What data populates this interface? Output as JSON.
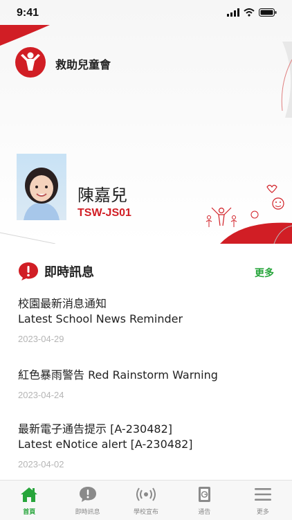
{
  "status_bar": {
    "time": "9:41"
  },
  "header": {
    "org_name": "救助兒童會"
  },
  "profile": {
    "name": "陳嘉兒",
    "student_id": "TSW-JS01"
  },
  "messages_section": {
    "title": "即時訊息",
    "more_label": "更多"
  },
  "news": [
    {
      "title_line1": "校園最新消息通知",
      "title_line2": "Latest School News Reminder",
      "date": "2023-04-29"
    },
    {
      "title_line1": "紅色暴雨警告 Red Rainstorm Warning",
      "title_line2": "",
      "date": "2023-04-24"
    },
    {
      "title_line1": "最新電子通告提示 [A-230482]",
      "title_line2": "Latest eNotice alert [A-230482]",
      "date": "2023-04-02"
    }
  ],
  "tabs": [
    {
      "label": "首頁",
      "icon": "home-icon",
      "active": true
    },
    {
      "label": "即時訊息",
      "icon": "message-icon"
    },
    {
      "label": "學校宣布",
      "icon": "broadcast-icon"
    },
    {
      "label": "通告",
      "icon": "notice-icon"
    },
    {
      "label": "更多",
      "icon": "menu-icon"
    }
  ],
  "colors": {
    "brand_red": "#d11e25",
    "accent_green": "#27a53b",
    "date_gray": "#b5b5b5"
  }
}
